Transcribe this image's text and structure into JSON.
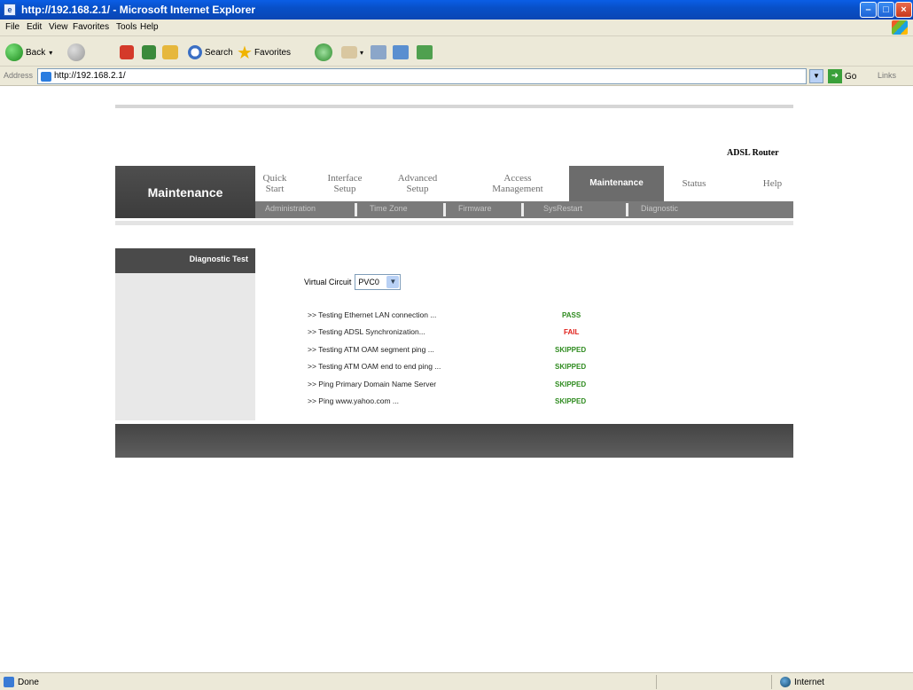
{
  "window": {
    "title": "http://192.168.2.1/ - Microsoft Internet Explorer"
  },
  "menu": [
    "File",
    "Edit",
    "View",
    "Favorites",
    "Tools",
    "Help"
  ],
  "toolbar": {
    "back_label": "Back",
    "search_label": "Search",
    "favorites_label": "Favorites"
  },
  "address": {
    "label": "Address",
    "url": "http://192.168.2.1/",
    "go_label": "Go",
    "links_label": "Links"
  },
  "router": {
    "brand": "ADSL Router",
    "section_title": "Maintenance",
    "nav_tabs": [
      {
        "label": "Quick\nStart"
      },
      {
        "label": "Interface\nSetup"
      },
      {
        "label": "Advanced\nSetup"
      },
      {
        "label": "Access\nManagement"
      },
      {
        "label": "Maintenance"
      },
      {
        "label": "Status"
      },
      {
        "label": "Help"
      }
    ],
    "sub_tabs": [
      "Administration",
      "Time Zone",
      "Firmware",
      "SysRestart",
      "Diagnostic"
    ],
    "side_title": "Diagnostic Test",
    "virtual_circuit": {
      "label": "Virtual Circuit",
      "value": "PVC0"
    },
    "tests": [
      {
        "name": ">> Testing Ethernet LAN connection ...",
        "result": "PASS"
      },
      {
        "name": ">> Testing ADSL Synchronization...",
        "result": "FAIL"
      },
      {
        "name": ">> Testing ATM OAM segment ping ...",
        "result": "SKIPPED"
      },
      {
        "name": ">> Testing ATM OAM end to end ping ...",
        "result": "SKIPPED"
      },
      {
        "name": ">> Ping Primary Domain Name Server",
        "result": "SKIPPED"
      },
      {
        "name": ">> Ping www.yahoo.com ...",
        "result": "SKIPPED"
      }
    ],
    "colors": {
      "pass": "#2e8b1f",
      "fail": "#e0201a",
      "skipped": "#2e8b1f"
    }
  },
  "status": {
    "left": "Done",
    "zone": "Internet"
  }
}
